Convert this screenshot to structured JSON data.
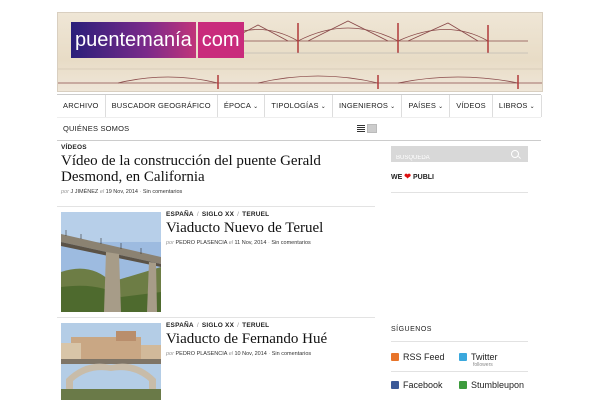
{
  "header": {
    "logo_part1": "puentemanía",
    "logo_part2": "com"
  },
  "nav": {
    "items": [
      {
        "label": "ARCHIVO",
        "dropdown": false
      },
      {
        "label": "BUSCADOR GEOGRÁFICO",
        "dropdown": false
      },
      {
        "label": "ÉPOCA",
        "dropdown": true
      },
      {
        "label": "TIPOLOGÍAS",
        "dropdown": true
      },
      {
        "label": "INGENIEROS",
        "dropdown": true
      },
      {
        "label": "PAÍSES",
        "dropdown": true
      },
      {
        "label": "VÍDEOS",
        "dropdown": false
      },
      {
        "label": "LIBROS",
        "dropdown": true
      }
    ],
    "row2": [
      {
        "label": "QUIÉNES SOMOS"
      }
    ],
    "chevron": "⌄"
  },
  "posts": [
    {
      "categories": [
        "VÍDEOS"
      ],
      "title": "Vídeo de la construcción del puente Gerald Desmond, en California",
      "by": "por",
      "author": "J JIMÉNEZ",
      "on": "el",
      "date": "19 Nov, 2014",
      "comments": "Sin comentarios"
    },
    {
      "categories": [
        "ESPAÑA",
        "SIGLO XX",
        "TERUEL"
      ],
      "title": "Viaducto Nuevo de Teruel",
      "by": "por",
      "author": "PEDRO PLASENCIA",
      "on": "el",
      "date": "11 Nov, 2014",
      "comments": "Sin comentarios"
    },
    {
      "categories": [
        "ESPAÑA",
        "SIGLO XX",
        "TERUEL"
      ],
      "title": "Viaducto de Fernando Hué",
      "by": "por",
      "author": "PEDRO PLASENCIA",
      "on": "el",
      "date": "10 Nov, 2014",
      "comments": "Sin comentarios"
    }
  ],
  "sidebar": {
    "search_placeholder": "BUSQUEDA",
    "publi_we": "WE",
    "publi_heart": "❤",
    "publi_label": "PUBLI",
    "follow_title": "SÍGUENOS",
    "social": [
      {
        "label": "RSS Feed",
        "icon": "rss-icon",
        "color": "#e8742a"
      },
      {
        "label": "Twitter",
        "sub": "followers",
        "icon": "twitter-icon",
        "color": "#3aa8dd"
      },
      {
        "label": "Facebook",
        "icon": "facebook-icon",
        "color": "#3b5998"
      },
      {
        "label": "Stumbleupon",
        "icon": "stumbleupon-icon",
        "color": "#3c9b3c"
      }
    ]
  },
  "colors": {
    "accent": "#c92b7c",
    "logo_gradient_start": "#2a1f7a"
  }
}
